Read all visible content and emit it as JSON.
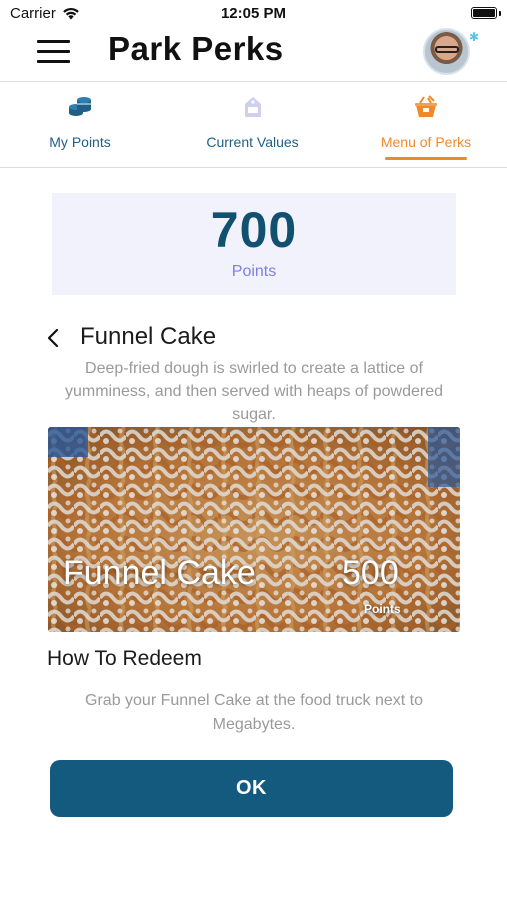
{
  "status_bar": {
    "carrier": "Carrier",
    "time": "12:05 PM"
  },
  "nav": {
    "title": "Park Perks",
    "menu_icon": "hamburger-menu-icon",
    "avatar_icon": "user-avatar"
  },
  "tabs": [
    {
      "label": "My Points",
      "icon": "coins-stack-icon",
      "active": false
    },
    {
      "label": "Current Values",
      "icon": "price-tag-icon",
      "active": false
    },
    {
      "label": "Menu of Perks",
      "icon": "food-basket-icon",
      "active": true
    }
  ],
  "points": {
    "value": "700",
    "label": "Points"
  },
  "perk": {
    "title": "Funnel Cake",
    "description": "Deep-fried dough is swirled to create a lattice of yumminess,  and then served with heaps of powdered sugar.",
    "image_name": "Funnel Cake",
    "image_points": "500",
    "image_points_label": "Points"
  },
  "redeem": {
    "title": "How To Redeem",
    "text": "Grab your Funnel Cake at the food truck next to Megabytes."
  },
  "ok_button": "OK",
  "colors": {
    "brand_dark": "#135a7e",
    "active_tab": "#ef8a2b",
    "points_label": "#7f7fe0",
    "card_bg": "#f1f2fc"
  }
}
